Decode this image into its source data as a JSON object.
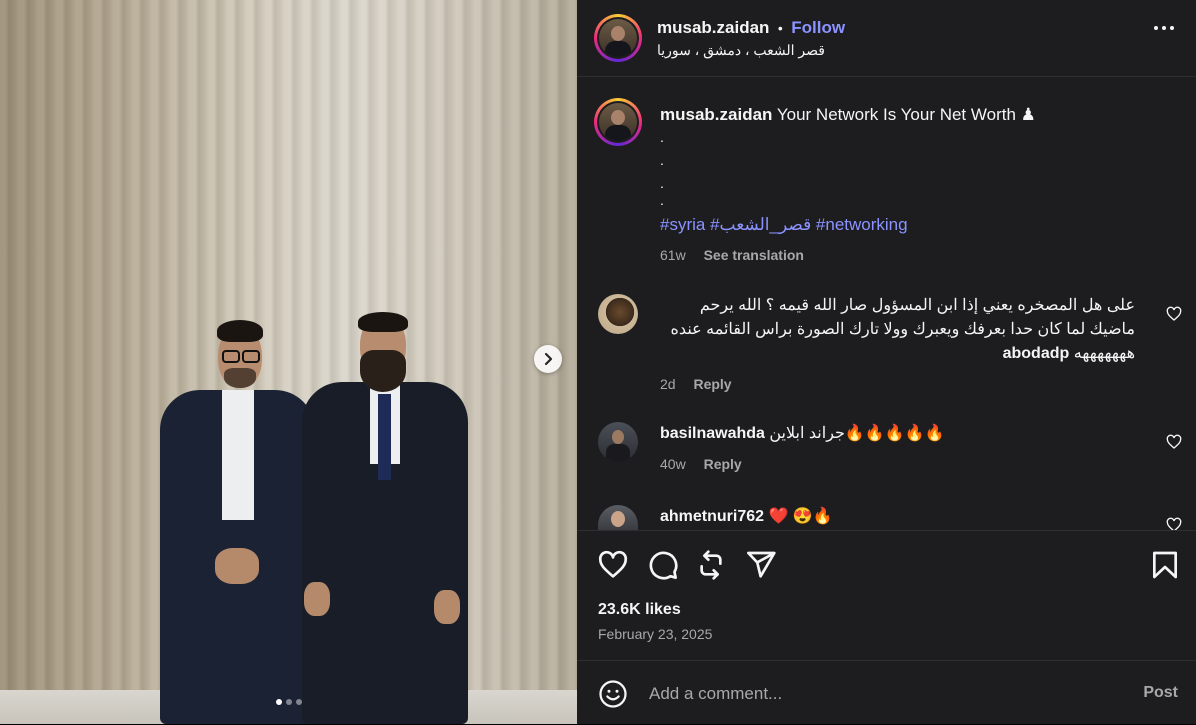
{
  "header": {
    "username": "musab.zaidan",
    "separator": "•",
    "follow_label": "Follow",
    "location": "قصر الشعب ، دمشق ، سوريا",
    "more_icon": "more-horizontal-icon"
  },
  "caption": {
    "username": "musab.zaidan",
    "text": "Your Network Is Your Net Worth ♟",
    "dots": [
      ".",
      ".",
      ".",
      "."
    ],
    "hashtags": "#syria #قصر_الشعب #networking",
    "time": "61w",
    "see_translation": "See translation"
  },
  "comments": [
    {
      "username": "abodadp",
      "text": "على هل المصخره يعني إذا ابن المسؤول صار الله قيمه ؟ الله يرحم ماضيك لما كان حدا بعرفك ويعبرك وولا تارك الصورة براس القائمه عنده هههههههه",
      "time": "2d",
      "reply_label": "Reply"
    },
    {
      "username": "basilnawahda",
      "text": "🔥🔥🔥🔥🔥جراند ابلاين",
      "time": "40w",
      "reply_label": "Reply"
    },
    {
      "username": "ahmetnuri762",
      "text": "❤️ 😍🔥",
      "time": "",
      "reply_label": ""
    }
  ],
  "actions": {
    "likes": "23.6K likes",
    "date": "February 23, 2025",
    "icons": [
      "heart-icon",
      "comment-icon",
      "share-icon",
      "send-icon",
      "bookmark-icon"
    ]
  },
  "add_comment": {
    "placeholder": "Add a comment...",
    "post_label": "Post"
  },
  "media": {
    "slide_count": 3,
    "active_slide": 1
  }
}
